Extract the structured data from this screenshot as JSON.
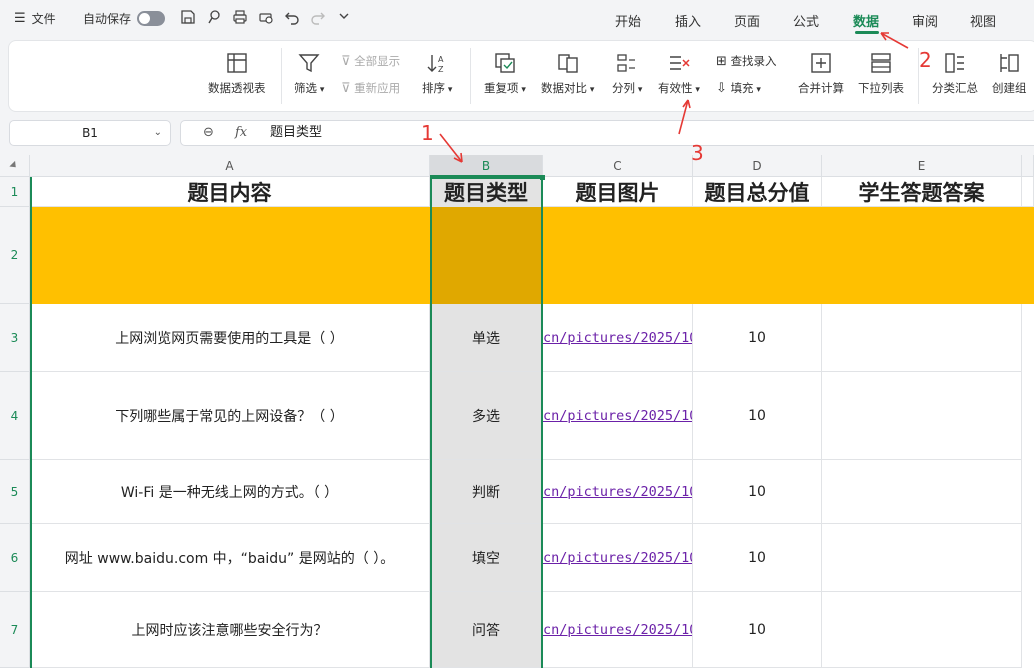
{
  "topbar": {
    "menu_label": "文件",
    "autosave_label": "自动保存",
    "tabs": [
      "开始",
      "插入",
      "页面",
      "公式",
      "数据",
      "审阅",
      "视图"
    ],
    "active_tab": "数据"
  },
  "ribbon": {
    "pivot": "数据透视表",
    "filter": "筛选",
    "show_all": "全部显示",
    "reapply": "重新应用",
    "sort": "排序",
    "duplicates": "重复项",
    "compare": "数据对比",
    "split": "分列",
    "validity": "有效性",
    "lookup_entry": "查找录入",
    "fill": "填充",
    "consolidate": "合并计算",
    "dropdown_list": "下拉列表",
    "subtotal": "分类汇总",
    "create_group": "创建组"
  },
  "formula_bar": {
    "cell_ref": "B1",
    "fx": "fx",
    "value": "题目类型"
  },
  "sheet": {
    "columns": [
      "A",
      "B",
      "C",
      "D",
      "E"
    ],
    "rows": [
      "1",
      "2",
      "3",
      "4",
      "5",
      "6",
      "7"
    ],
    "header": [
      "题目内容",
      "题目类型",
      "题目图片",
      "题目总分值",
      "学生答题答案"
    ],
    "data": [
      [
        "上网浏览网页需要使用的工具是（ ）",
        "单选",
        "cn/pictures/2025/10",
        "10",
        ""
      ],
      [
        "下列哪些属于常见的上网设备？（ ）",
        "多选",
        "cn/pictures/2025/10",
        "10",
        ""
      ],
      [
        "Wi-Fi 是一种无线上网的方式。（ ）",
        "判断",
        "cn/pictures/2025/10",
        "10",
        ""
      ],
      [
        "网址 www.baidu.com 中，“baidu” 是网站的（ ）。",
        "填空",
        "cn/pictures/2025/10",
        "10",
        ""
      ],
      [
        "上网时应该注意哪些安全行为？",
        "问答",
        "cn/pictures/2025/10",
        "10",
        ""
      ]
    ]
  },
  "annotations": [
    "1",
    "2",
    "3"
  ],
  "colors": {
    "accent": "#1b8a57",
    "highlight_row": "#ffc000",
    "annotation": "#e53935"
  }
}
